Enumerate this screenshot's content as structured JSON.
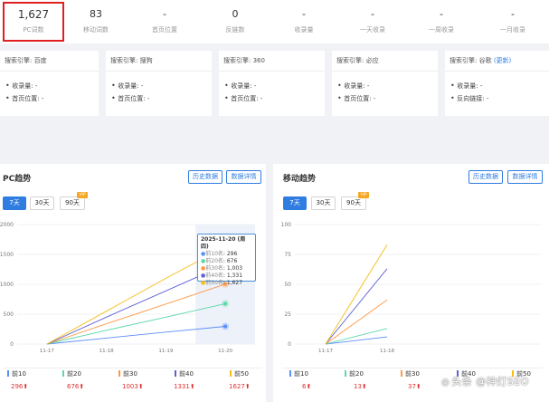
{
  "stats": [
    {
      "value": "1,627",
      "label": "PC词数"
    },
    {
      "value": "83",
      "label": "移动词数"
    },
    {
      "value": "-",
      "label": "首页位置"
    },
    {
      "value": "0",
      "label": "反链数"
    },
    {
      "value": "-",
      "label": "收录量"
    },
    {
      "value": "-",
      "label": "一天收录"
    },
    {
      "value": "-",
      "label": "一周收录"
    },
    {
      "value": "-",
      "label": "一月收录"
    }
  ],
  "engines": [
    {
      "title": "搜索引擎: 百度",
      "update": "",
      "rows": [
        {
          "label": "收录量:",
          "value": "-"
        },
        {
          "label": "首页位置:",
          "value": "-"
        }
      ]
    },
    {
      "title": "搜索引擎: 搜狗",
      "update": "",
      "rows": [
        {
          "label": "收录量:",
          "value": "-"
        },
        {
          "label": "首页位置:",
          "value": "-"
        }
      ]
    },
    {
      "title": "搜索引擎: 360",
      "update": "",
      "rows": [
        {
          "label": "收录量:",
          "value": "-"
        },
        {
          "label": "首页位置:",
          "value": "-"
        }
      ]
    },
    {
      "title": "搜索引擎: 必应",
      "update": "",
      "rows": [
        {
          "label": "收录量:",
          "value": "-"
        },
        {
          "label": "首页位置:",
          "value": "-"
        }
      ]
    },
    {
      "title": "搜索引擎: 谷歌",
      "update": "(更新)",
      "rows": [
        {
          "label": "收录量:",
          "value": "-"
        },
        {
          "label": "反向链接:",
          "value": "-"
        }
      ]
    }
  ],
  "pc_panel": {
    "title": "PC趋势",
    "history_btn": "历史数据",
    "details_btn": "数据详情",
    "tabs": [
      "7天",
      "30天",
      "90天"
    ],
    "vip_badge": "VIP",
    "tooltip": {
      "date": "2025-11-20 (周四)",
      "rows": [
        {
          "name": "前10名",
          "value": "296"
        },
        {
          "name": "前20名",
          "value": "676"
        },
        {
          "name": "前30名",
          "value": "1,003"
        },
        {
          "name": "前40名",
          "value": "1,331"
        },
        {
          "name": "前50名",
          "value": "1,627"
        }
      ]
    },
    "legend": [
      {
        "name": "前10",
        "value": "296"
      },
      {
        "name": "前20",
        "value": "676"
      },
      {
        "name": "前30",
        "value": "1003"
      },
      {
        "name": "前40",
        "value": "1331"
      },
      {
        "name": "前50",
        "value": "1627"
      }
    ]
  },
  "mobile_panel": {
    "title": "移动趋势",
    "history_btn": "历史数据",
    "details_btn": "数据详情",
    "tabs": [
      "7天",
      "30天",
      "90天"
    ],
    "vip_badge": "VIP",
    "legend": [
      {
        "name": "前10",
        "value": "6"
      },
      {
        "name": "前20",
        "value": "13"
      },
      {
        "name": "前30",
        "value": "37"
      },
      {
        "name": "前40",
        "value": ""
      },
      {
        "name": "前50",
        "value": ""
      }
    ]
  },
  "watermark": "头条 @神灯SEO",
  "colors": {
    "top10": "#5b8ff9",
    "top20": "#5ad8a6",
    "top30": "#ff9845",
    "top40": "#5d5fd6",
    "top50": "#f6bd16",
    "accent": "#2f7de1",
    "highlight": "#e02020"
  },
  "chart_data": [
    {
      "type": "line",
      "title": "PC趋势",
      "x": [
        "11-17",
        "11-18",
        "11-19",
        "11-20"
      ],
      "ylim": [
        0,
        2000
      ],
      "yticks": [
        0,
        500,
        1000,
        1500,
        2000
      ],
      "grid": true,
      "legend_position": "bottom",
      "series": [
        {
          "name": "前10",
          "values": [
            0,
            100,
            200,
            296
          ]
        },
        {
          "name": "前20",
          "values": [
            0,
            230,
            450,
            676
          ]
        },
        {
          "name": "前30",
          "values": [
            0,
            340,
            670,
            1003
          ]
        },
        {
          "name": "前40",
          "values": [
            0,
            450,
            890,
            1331
          ]
        },
        {
          "name": "前50",
          "values": [
            0,
            550,
            1100,
            1627
          ]
        }
      ]
    },
    {
      "type": "line",
      "title": "移动趋势",
      "x": [
        "11-17",
        "11-18"
      ],
      "ylim": [
        0,
        100
      ],
      "yticks": [
        0,
        25,
        50,
        75,
        100
      ],
      "grid": true,
      "legend_position": "bottom",
      "series": [
        {
          "name": "前10",
          "values": [
            0,
            6
          ]
        },
        {
          "name": "前20",
          "values": [
            0,
            13
          ]
        },
        {
          "name": "前30",
          "values": [
            0,
            37
          ]
        },
        {
          "name": "前40",
          "values": [
            0,
            63
          ]
        },
        {
          "name": "前50",
          "values": [
            0,
            83
          ]
        }
      ]
    }
  ]
}
